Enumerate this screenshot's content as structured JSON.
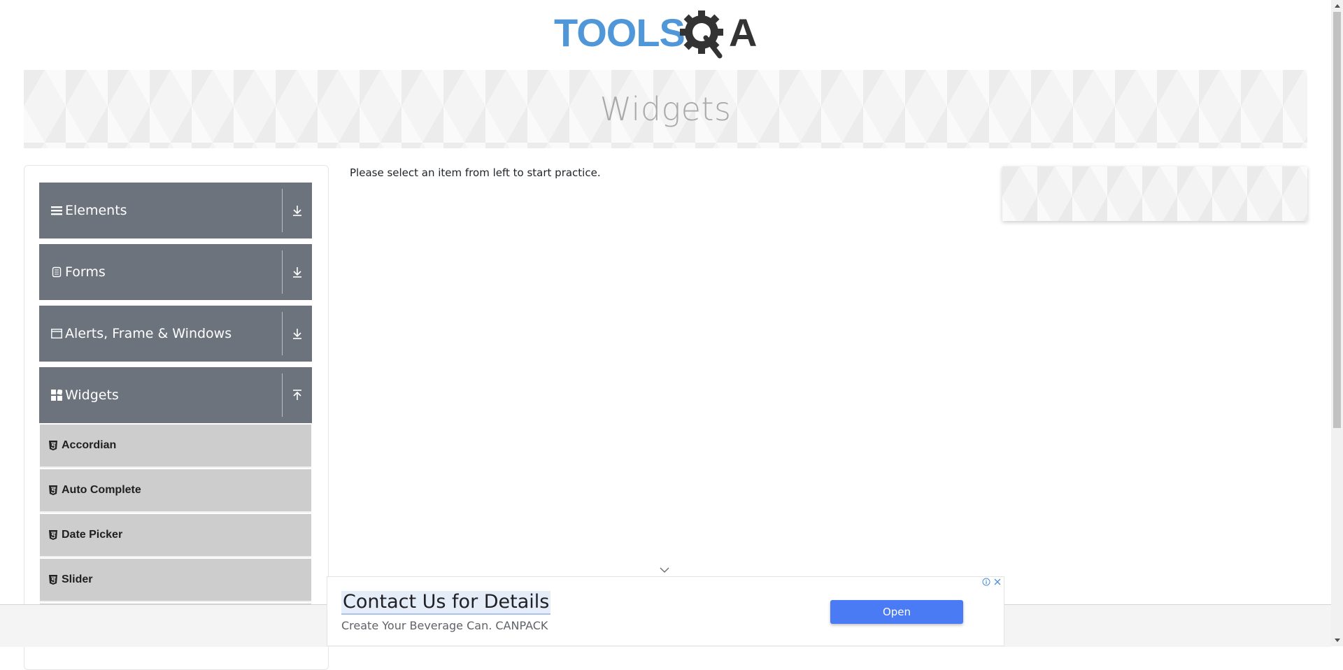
{
  "logo": {
    "text_part": "TOOLS",
    "brand_part": "QA"
  },
  "banner": {
    "title": "Widgets"
  },
  "sidebar": {
    "groups": [
      {
        "label": "Elements",
        "icon": "hamburger-icon",
        "state": "collapsed"
      },
      {
        "label": "Forms",
        "icon": "form-icon",
        "state": "collapsed"
      },
      {
        "label": "Alerts, Frame & Windows",
        "icon": "window-icon",
        "state": "collapsed"
      },
      {
        "label": "Widgets",
        "icon": "widgets-icon",
        "state": "expanded"
      }
    ],
    "items": [
      {
        "label": "Accordian",
        "icon": "html5-icon"
      },
      {
        "label": "Auto Complete",
        "icon": "html5-icon"
      },
      {
        "label": "Date Picker",
        "icon": "html5-icon"
      },
      {
        "label": "Slider",
        "icon": "html5-icon"
      }
    ]
  },
  "main": {
    "message": "Please select an item from left to start practice."
  },
  "ad": {
    "title": "Contact Us for Details",
    "subtitle": "Create Your Beverage Can. CANPACK",
    "button": "Open"
  },
  "colors": {
    "sidebar_group_bg": "#6c737d",
    "sidebar_item_bg": "#cdcdcd",
    "logo_blue": "#4f97d8",
    "logo_dark": "#333333",
    "ad_button": "#4a7bf4"
  }
}
